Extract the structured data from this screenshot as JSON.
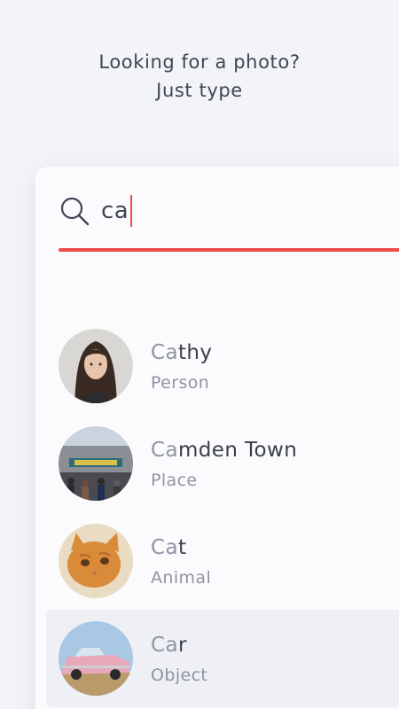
{
  "header": {
    "line1": "Looking for a photo?",
    "line2": "Just type"
  },
  "search": {
    "query": "ca",
    "icon": "search-icon"
  },
  "colors": {
    "accent": "#ef4a45",
    "background": "#f3f4f8",
    "card": "#fbfbfd",
    "text": "#3a3f4c",
    "muted": "#8e94a2",
    "selected_row": "#eef0f5"
  },
  "results": [
    {
      "match": "Ca",
      "rest": "thy",
      "type": "Person",
      "thumbnail": "person-photo"
    },
    {
      "match": "Ca",
      "rest": "mden Town",
      "type": "Place",
      "thumbnail": "place-photo"
    },
    {
      "match": "Ca",
      "rest": "t",
      "type": "Animal",
      "thumbnail": "cat-photo"
    },
    {
      "match": "Ca",
      "rest": "r",
      "type": "Object",
      "thumbnail": "car-photo"
    }
  ]
}
